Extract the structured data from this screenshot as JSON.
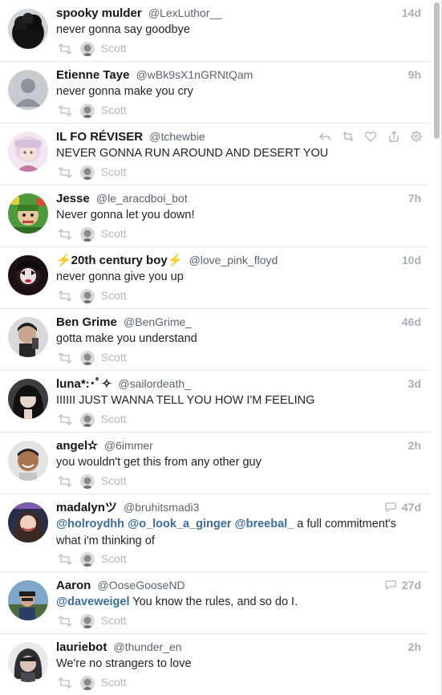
{
  "footer_label": "Scott",
  "tweets": [
    {
      "name": "spooky mulder",
      "handle": "@LexLuthor__",
      "time": "14d",
      "text": "never gonna say goodbye"
    },
    {
      "name": "Etienne Taye",
      "handle": "@wBk9sX1nGRNtQam",
      "time": "9h",
      "text": "never gonna make you cry"
    },
    {
      "name": "IL FO RÉVISER",
      "handle": "@tchewbie",
      "time": "",
      "text": "NEVER GONNA RUN AROUND AND DESERT YOU"
    },
    {
      "name": "Jesse",
      "handle": "@le_aracdboi_bot",
      "time": "7h",
      "text": "Never gonna let you down!"
    },
    {
      "name": "⚡20th century boy⚡",
      "handle": "@love_pink_floyd",
      "time": "10d",
      "text": "never gonna give you up"
    },
    {
      "name": "Ben Grime",
      "handle": "@BenGrime_",
      "time": "46d",
      "text": "gotta make you understand"
    },
    {
      "name": "luna*:･ﾟ✧",
      "handle": "@sailordeath_",
      "time": "3d",
      "text": "IIIIII JUST WANNA TELL YOU HOW I'M FEELING"
    },
    {
      "name": "angel✫",
      "handle": "@6immer",
      "time": "2h",
      "text": "you wouldn't get this from any other guy"
    },
    {
      "name": "madalynツ",
      "handle": "@bruhitsmadi3",
      "time": "47d",
      "mentions": [
        "@holroydhh",
        "@o_look_a_ginger",
        "@breebal_"
      ],
      "text": " a full commitment's what i'm thinking of"
    },
    {
      "name": "Aaron",
      "handle": "@OoseGooseND",
      "time": "27d",
      "mentions": [
        "@daveweigel"
      ],
      "text": " You know the rules, and so do I."
    },
    {
      "name": "lauriebot",
      "handle": "@thunder_en",
      "time": "2h",
      "text": "We're no strangers to love"
    }
  ]
}
